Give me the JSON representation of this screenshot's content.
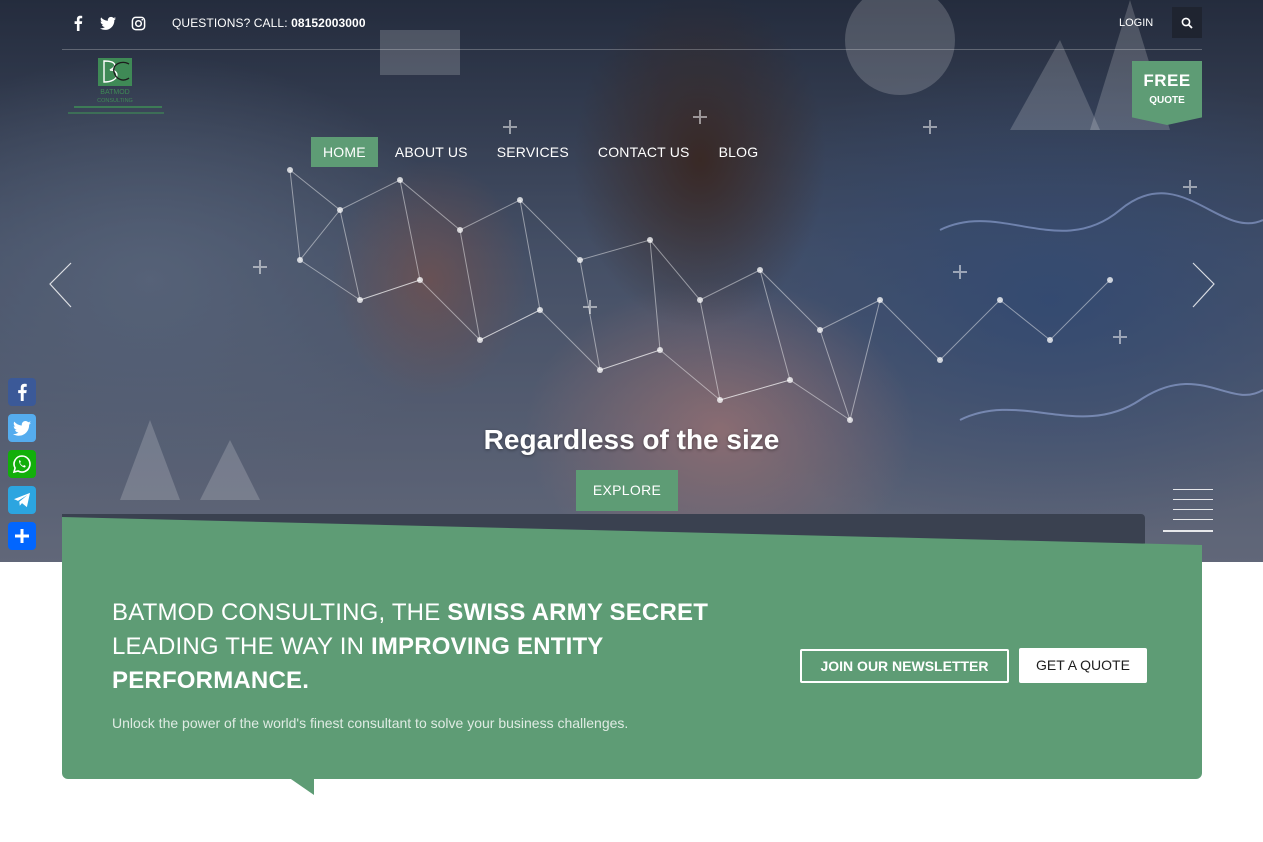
{
  "topbar": {
    "questions_label": "QUESTIONS? CALL:",
    "phone": "08152003000",
    "login_label": "LOGIN",
    "social_icons": [
      "facebook-icon",
      "twitter-icon",
      "instagram-icon"
    ]
  },
  "logo": {
    "name": "BATMOD",
    "subtitle": "CONSULTING"
  },
  "free_quote": {
    "line1": "FREE",
    "line2": "QUOTE"
  },
  "nav": {
    "items": [
      {
        "label": "HOME",
        "active": true
      },
      {
        "label": "ABOUT US",
        "active": false
      },
      {
        "label": "SERVICES",
        "active": false
      },
      {
        "label": "CONTACT US",
        "active": false
      },
      {
        "label": "BLOG",
        "active": false
      }
    ]
  },
  "hero": {
    "caption": "Regardless of the size",
    "button_label": "EXPLORE"
  },
  "share_bar": {
    "icons": [
      "facebook-icon",
      "twitter-icon",
      "whatsapp-icon",
      "telegram-icon",
      "share-icon"
    ]
  },
  "cta": {
    "heading_part1": "BATMOD CONSULTING, THE ",
    "heading_bold1": "SWISS ARMY SECRET",
    "heading_part2": "LEADING THE WAY IN ",
    "heading_bold2": "IMPROVING ENTITY PERFORMANCE.",
    "subtext": "Unlock the power of the world's finest consultant to solve your business challenges.",
    "newsletter_label": "JOIN OUR NEWSLETTER",
    "quote_label": "GET A QUOTE"
  },
  "colors": {
    "accent_green": "#5e9c75",
    "facebook": "#3b5998",
    "twitter": "#55acee",
    "whatsapp": "#12af0a",
    "telegram": "#2ca5e0",
    "share": "#0166ff"
  }
}
